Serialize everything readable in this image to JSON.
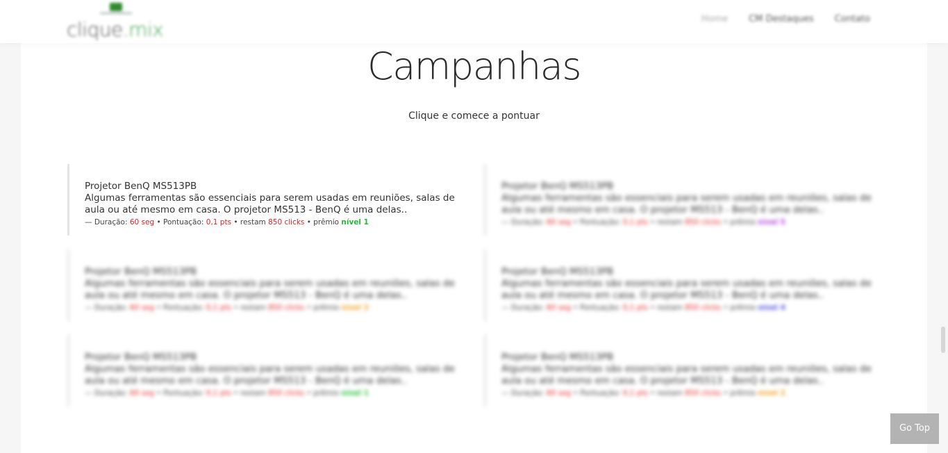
{
  "header": {
    "logo_text_main": "clique.",
    "logo_text_accent": "mix",
    "nav": [
      {
        "label": "Home",
        "active": true
      },
      {
        "label": "CM Destaques",
        "active": false
      },
      {
        "label": "Contato",
        "active": false
      }
    ]
  },
  "main": {
    "title": "Campanhas",
    "subtitle": "Clique e comece a pontuar"
  },
  "meta_labels": {
    "prefix": "— Duração: ",
    "sep_points": " • Pontuação: ",
    "sep_remaining": " • restam ",
    "sep_prize": " • prêmio "
  },
  "campaigns": [
    {
      "title": "Projetor BenQ MS513PB",
      "description": "Algumas ferramentas são essenciais para serem usadas em reuniões, salas de aula ou até mesmo em casa. O projetor MS513 - BenQ é uma delas..",
      "duration": "60 seg",
      "points": "0,1 pts",
      "remaining": "850 clicks",
      "prize": "nível 1",
      "prize_color": "#22bb33"
    },
    {
      "title": "Projetor BenQ MS513PB",
      "description": "Algumas ferramentas são essenciais para serem usadas em reuniões, salas de aula ou até mesmo em casa. O projetor MS513 - BenQ é uma delas..",
      "duration": "60 seg",
      "points": "0,1 pts",
      "remaining": "850 clicks",
      "prize": "nível 5",
      "prize_color": "#b040e0"
    },
    {
      "title": "Projetor BenQ MS513PB",
      "description": "Algumas ferramentas são essenciais para serem usadas em reuniões, salas de aula ou até mesmo em casa. O projetor MS513 - BenQ é uma delas..",
      "duration": "60 seg",
      "points": "0,1 pts",
      "remaining": "850 clicks",
      "prize": "nível 2",
      "prize_color": "#f0a020"
    },
    {
      "title": "Projetor BenQ MS513PB",
      "description": "Algumas ferramentas são essenciais para serem usadas em reuniões, salas de aula ou até mesmo em casa. O projetor MS513 - BenQ é uma delas..",
      "duration": "60 seg",
      "points": "0,1 pts",
      "remaining": "850 clicks",
      "prize": "nível 4",
      "prize_color": "#5050e0"
    },
    {
      "title": "Projetor BenQ MS513PB",
      "description": "Algumas ferramentas são essenciais para serem usadas em reuniões, salas de aula ou até mesmo em casa. O projetor MS513 - BenQ é uma delas..",
      "duration": "60 seg",
      "points": "0,1 pts",
      "remaining": "850 clicks",
      "prize": "nível 1",
      "prize_color": "#22bb33"
    },
    {
      "title": "Projetor BenQ MS513PB",
      "description": "Algumas ferramentas são essenciais para serem usadas em reuniões, salas de aula ou até mesmo em casa. O projetor MS513 - BenQ é uma delas..",
      "duration": "60 seg",
      "points": "0,1 pts",
      "remaining": "850 clicks",
      "prize": "nível 2",
      "prize_color": "#f0a020"
    }
  ],
  "go_top": {
    "label": "Go Top"
  },
  "colors": {
    "accent_red": "#e02020",
    "logo_green": "#2e9a3a",
    "go_top_bg": "#b3b3b3"
  }
}
